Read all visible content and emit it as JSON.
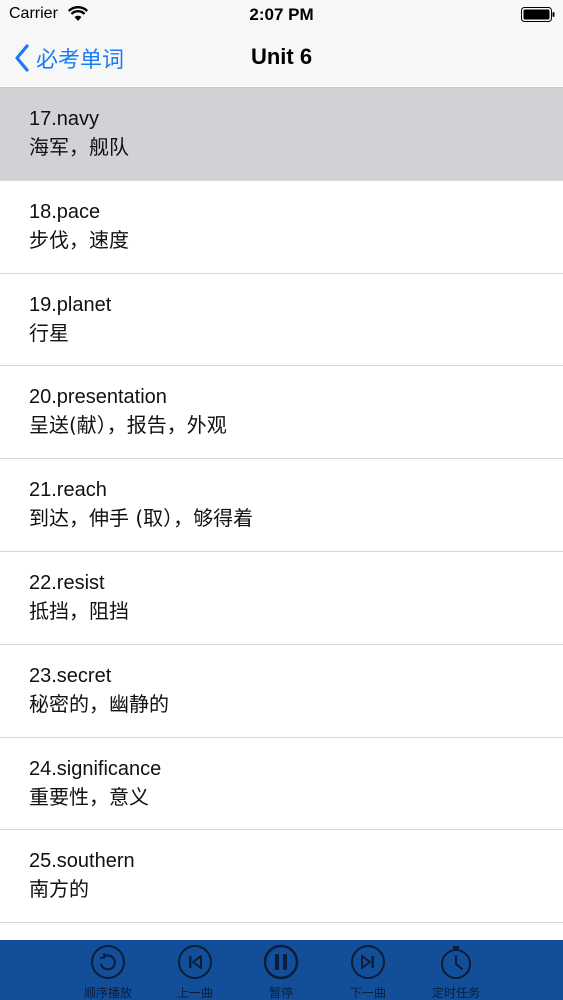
{
  "status_bar": {
    "carrier": "Carrier",
    "time": "2:07 PM"
  },
  "nav": {
    "back_label": "必考单词",
    "title": "Unit 6"
  },
  "words": [
    {
      "en": "17.navy",
      "cn": "海军，舰队",
      "selected": true
    },
    {
      "en": "18.pace",
      "cn": "步伐，速度"
    },
    {
      "en": "19.planet",
      "cn": "行星"
    },
    {
      "en": "20.presentation",
      "cn": "呈送(献），报告，外观"
    },
    {
      "en": "21.reach",
      "cn": "到达，伸手 (取），够得着"
    },
    {
      "en": "22.resist",
      "cn": "抵挡，阻挡"
    },
    {
      "en": "23.secret",
      "cn": "秘密的，幽静的"
    },
    {
      "en": "24.significance",
      "cn": "重要性，意义"
    },
    {
      "en": "25.southern",
      "cn": "南方的"
    }
  ],
  "player": {
    "order_label": "顺序播放",
    "prev_label": "上一曲",
    "pause_label": "暂停",
    "next_label": "下一曲",
    "timer_label": "定时任务"
  },
  "colors": {
    "accent": "#1a7cf5",
    "player_bar": "#124f98",
    "selected_row": "#d1d1d6"
  },
  "icons": {
    "back": "chevron-left-icon",
    "order": "repeat-icon",
    "prev": "skip-previous-icon",
    "pause": "pause-icon",
    "next": "skip-next-icon",
    "timer": "stopwatch-icon"
  }
}
